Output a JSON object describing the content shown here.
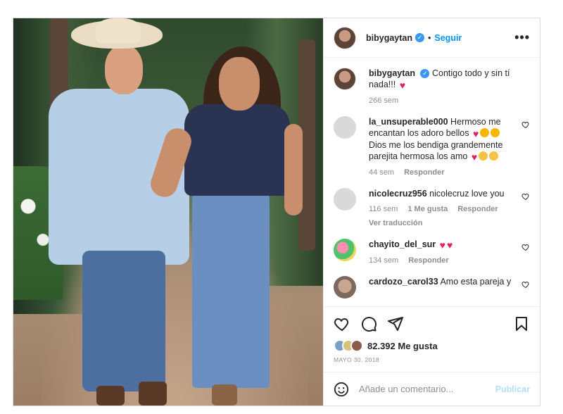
{
  "header": {
    "username": "bibygaytan",
    "separator": "•",
    "follow_label": "Seguir",
    "more_label": "•••"
  },
  "caption": {
    "username": "bibygaytan",
    "text": "Contigo todo y sin tí nada!!!",
    "time": "266 sem"
  },
  "comments": [
    {
      "username": "la_unsuperable000",
      "text": "Hermoso me encantan los adoro bellos",
      "text2": "Dios me los bendiga grandemente parejita hermosa los amo",
      "time": "44 sem",
      "reply_label": "Responder"
    },
    {
      "username": "nicolecruz956",
      "text": "nicolecruz love you",
      "time": "116 sem",
      "likes": "1 Me gusta",
      "reply_label": "Responder",
      "translate_label": "Ver traducción"
    },
    {
      "username": "chayito_del_sur",
      "text": "",
      "time": "134 sem",
      "reply_label": "Responder"
    },
    {
      "username": "cardozo_carol33",
      "text": "Amo esta pareja y"
    }
  ],
  "stats": {
    "likes": "82.392 Me gusta",
    "date": "MAYO 30, 2018"
  },
  "comment_box": {
    "placeholder": "Añade un comentario...",
    "publish_label": "Publicar"
  },
  "colors": {
    "link_blue": "#0095f6",
    "heart_red": "#e0245e",
    "muted": "#8e8e8e"
  },
  "icons": [
    "verified-badge-icon",
    "heart-icon",
    "comment-icon",
    "share-icon",
    "bookmark-icon",
    "smiley-icon"
  ]
}
